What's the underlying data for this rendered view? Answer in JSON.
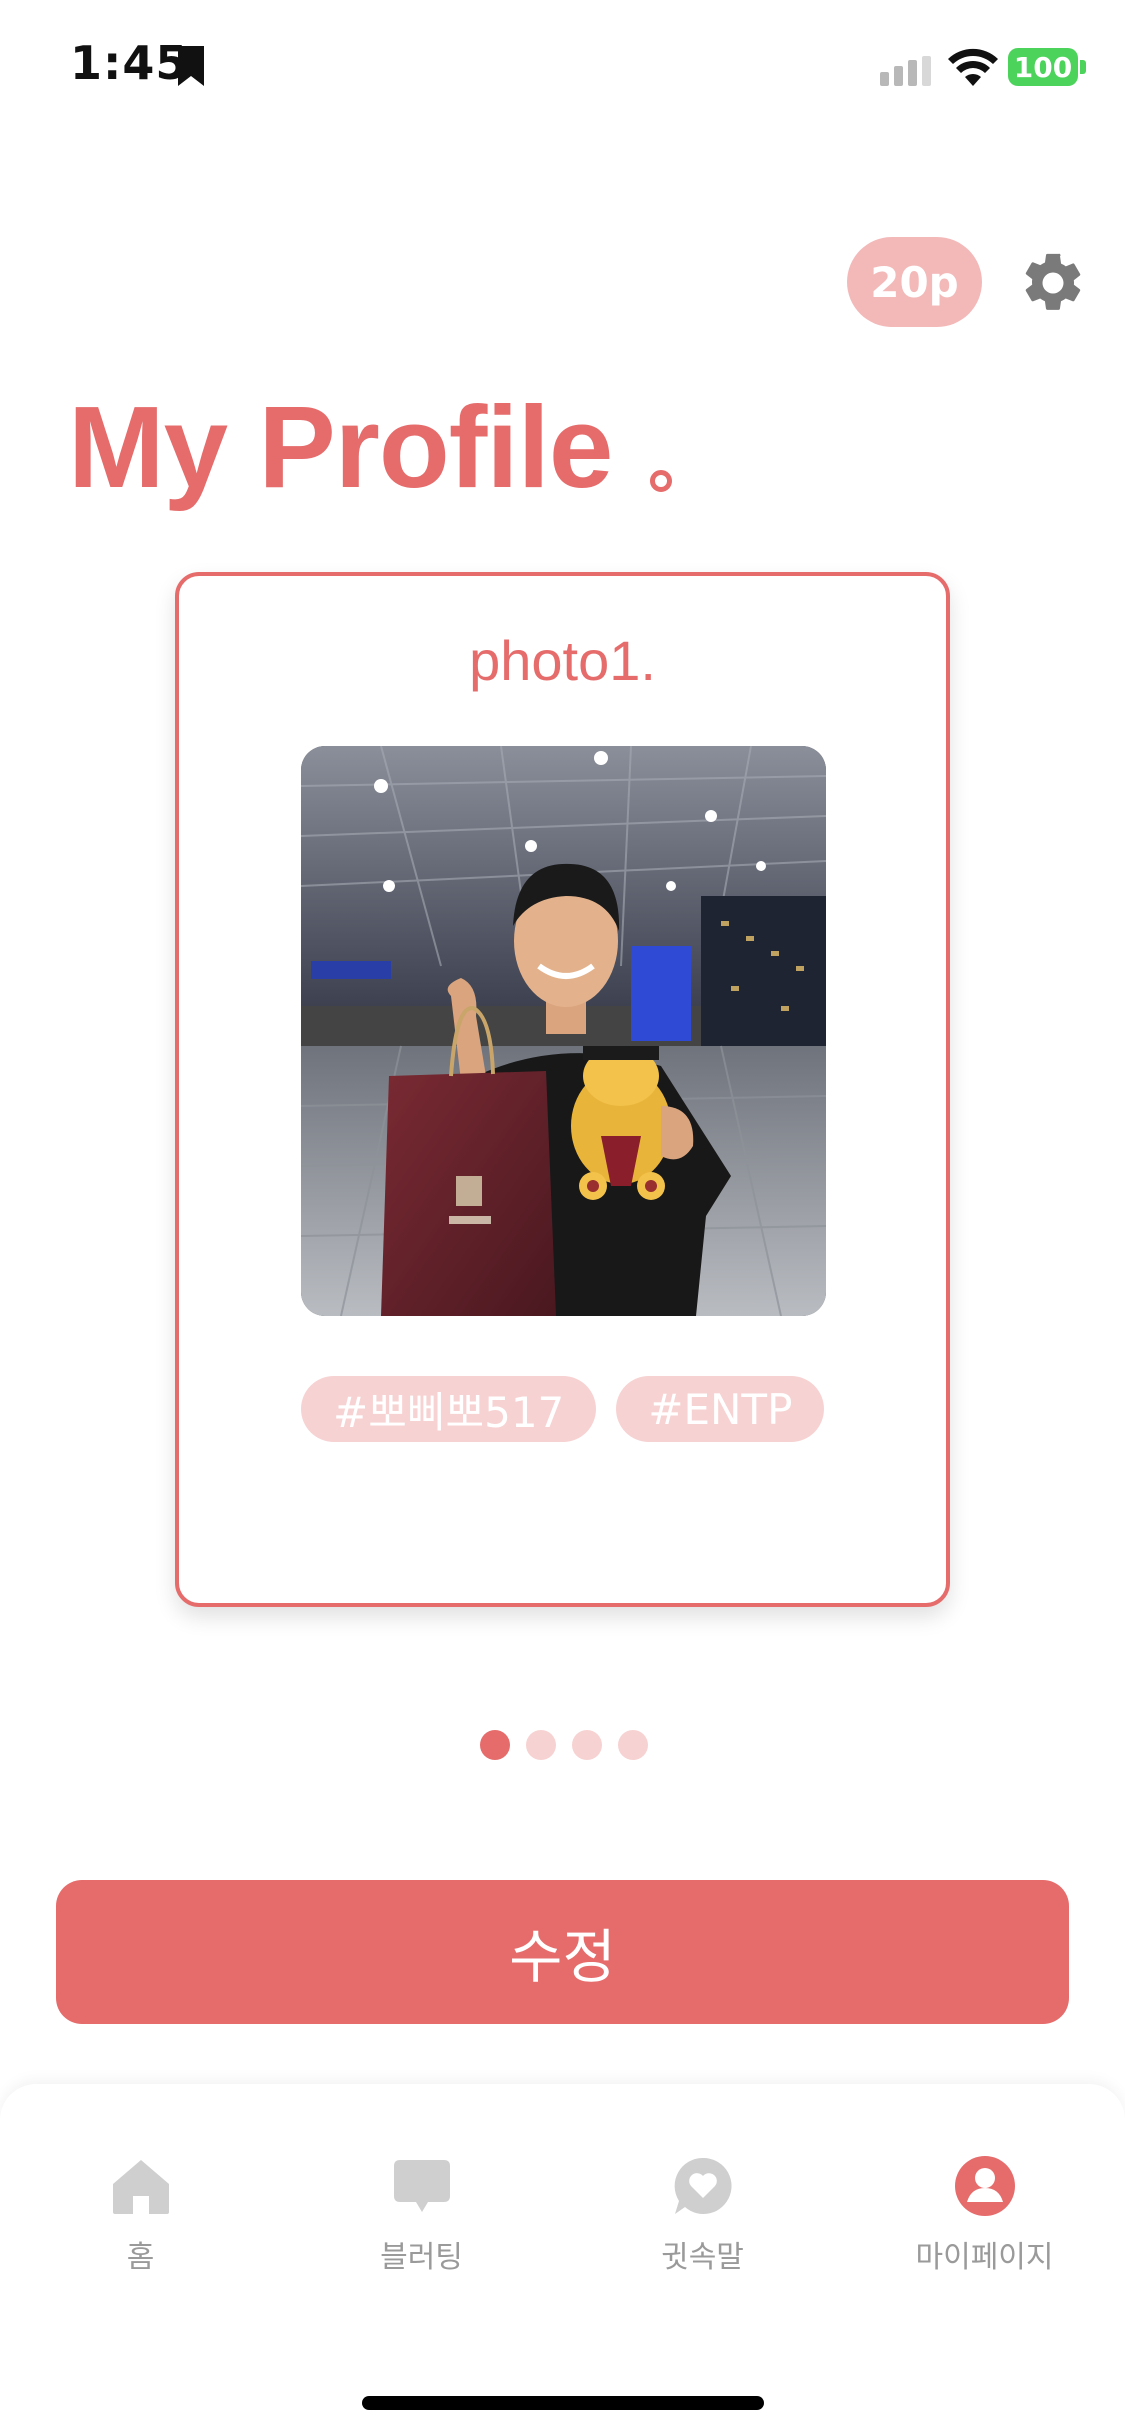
{
  "status_bar": {
    "time": "1:45",
    "battery": "100"
  },
  "header": {
    "points": "20p",
    "title": "My Profile"
  },
  "card": {
    "photo_label": "photo1.",
    "tags": [
      "#뽀삐뽀517",
      "#ENTP"
    ]
  },
  "pagination": {
    "total": 4,
    "active": 0
  },
  "actions": {
    "edit_label": "수정"
  },
  "tab_bar": {
    "items": [
      {
        "label": "홈",
        "icon": "home-icon"
      },
      {
        "label": "블러팅",
        "icon": "chat-bubble-icon"
      },
      {
        "label": "귓속말",
        "icon": "heart-message-icon"
      },
      {
        "label": "마이페이지",
        "icon": "person-icon"
      }
    ],
    "active_index": 3
  },
  "colors": {
    "accent": "#e66c6c",
    "accent_light": "#f7d2d2",
    "badge": "#f3b9b9",
    "inactive": "#cfcfcf"
  }
}
